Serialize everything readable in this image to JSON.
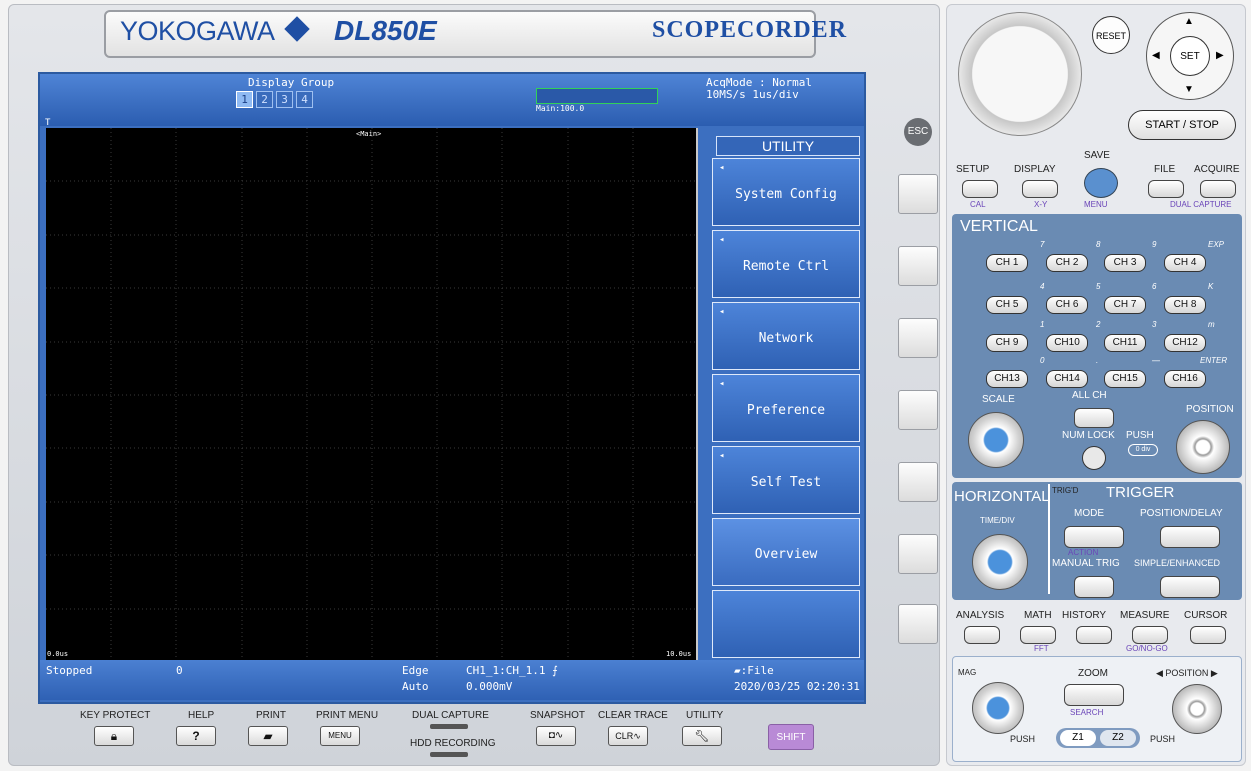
{
  "brand": {
    "name": "YOKOGAWA",
    "model": "DL850E",
    "series": "SCOPECORDER"
  },
  "header": {
    "display_group_label": "Display Group",
    "display_groups": [
      "1",
      "2",
      "3",
      "4"
    ],
    "main_label": "Main:100.0",
    "acq_line1": "AcqMode : Normal",
    "acq_line2": "10MS/s    1us/div"
  },
  "plot": {
    "title": "<Main>",
    "x_start": "0.0us",
    "x_end": "10.0us",
    "marker": "T"
  },
  "menu": {
    "title": "UTILITY",
    "items": [
      {
        "label": "System Config",
        "arrow": "◂"
      },
      {
        "label": "Remote Ctrl",
        "arrow": "◂"
      },
      {
        "label": "Network",
        "arrow": "◂"
      },
      {
        "label": "Preference",
        "arrow": "◂"
      },
      {
        "label": "Self Test",
        "arrow": "◂"
      },
      {
        "label": "Overview",
        "arrow": ""
      },
      {
        "label": "",
        "arrow": ""
      }
    ]
  },
  "status": {
    "state": "Stopped",
    "count": "0",
    "trig_type": "Edge",
    "trig_mode": "Auto",
    "trig_src": "CH1_1:CH_1.1 ⨍",
    "trig_level": "0.000mV",
    "save_target": "▰:File",
    "datetime": "2020/03/25 02:20:31"
  },
  "bottom": {
    "key_protect": "KEY PROTECT",
    "help": "HELP",
    "print": "PRINT",
    "print_menu": "PRINT MENU",
    "dual_capture": "DUAL CAPTURE",
    "hdd_recording": "HDD RECORDING",
    "snapshot": "SNAPSHOT",
    "clear_trace": "CLEAR TRACE",
    "utility": "UTILITY",
    "shift": "SHIFT",
    "help_glyph": "?",
    "menu_glyph": "MENU",
    "clr_glyph": "CLR∿",
    "snap_glyph": "◘∿"
  },
  "right": {
    "reset": "RESET",
    "set": "SET",
    "start_stop": "START / STOP",
    "esc": "ESC",
    "top_keys": [
      {
        "label": "SETUP",
        "sub": "CAL"
      },
      {
        "label": "DISPLAY",
        "sub": "X-Y"
      },
      {
        "label": "SAVE",
        "sub": "MENU"
      },
      {
        "label": "FILE",
        "sub": ""
      },
      {
        "label": "ACQUIRE",
        "sub": "DUAL CAPTURE"
      }
    ],
    "vertical": "VERTICAL",
    "channels": [
      "CH 1",
      "CH 2",
      "CH 3",
      "CH 4",
      "CH 5",
      "CH 6",
      "CH 7",
      "CH 8",
      "CH 9",
      "CH10",
      "CH11",
      "CH12",
      "CH13",
      "CH14",
      "CH15",
      "CH16"
    ],
    "num_hints": [
      "7",
      "8",
      "9",
      "EXP",
      "4",
      "5",
      "6",
      "K",
      "1",
      "2",
      "3",
      "m",
      "0",
      ".",
      "—",
      "ENTER"
    ],
    "scale": "SCALE",
    "all_ch": "ALL CH",
    "position": "POSITION",
    "num_lock": "NUM LOCK",
    "push": "PUSH",
    "zero_div": "0 div",
    "horizontal": "HORIZONTAL",
    "time_div": "TIME/DIV",
    "trigd": "TRIG'D",
    "trigger": "TRIGGER",
    "mode": "MODE",
    "position_delay": "POSITION/DELAY",
    "action": "ACTION",
    "manual_trig": "MANUAL TRIG",
    "simple_enhanced": "SIMPLE/ENHANCED",
    "analysis_keys": [
      {
        "label": "ANALYSIS",
        "sub": ""
      },
      {
        "label": "MATH",
        "sub": "FFT"
      },
      {
        "label": "HISTORY",
        "sub": ""
      },
      {
        "label": "MEASURE",
        "sub": "GO/NO-GO"
      },
      {
        "label": "CURSOR",
        "sub": ""
      }
    ],
    "mag": "MAG",
    "zoom": "ZOOM",
    "search": "SEARCH",
    "zoom_position": "◀ POSITION ▶",
    "z1": "Z1",
    "z2": "Z2",
    "push2": "PUSH"
  }
}
